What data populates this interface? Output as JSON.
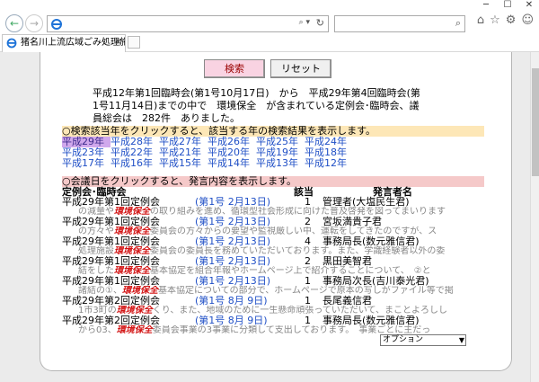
{
  "browser": {
    "tab_title": "猪名川上流広域ごみ処理施...",
    "address": "",
    "search_placeholder": ""
  },
  "buttons": {
    "search_label": "検索",
    "reset_label": "リセット"
  },
  "summary": "平成12年第1回臨時会(第1号10月17日)　から　平成29年第4回臨時会(第1号11月14日)までの中で　環境保全　が含まれている定例会･臨時会、議員総会は　282件　ありました。",
  "year_hint": "○検索該当年をクリックすると、該当する年の検索結果を表示します。",
  "years": [
    [
      "平成29年",
      "平成28年",
      "平成27年",
      "平成26年",
      "平成25年",
      "平成24年"
    ],
    [
      "平成23年",
      "平成22年",
      "平成21年",
      "平成20年",
      "平成19年",
      "平成18年"
    ],
    [
      "平成17年",
      "平成16年",
      "平成15年",
      "平成14年",
      "平成13年",
      "平成12年"
    ]
  ],
  "speaker_hint": "○会議日をクリックすると、発言内容を表示します。",
  "headers": {
    "meeting": "定例会･臨時会",
    "hit": "該当",
    "speaker": "発言者名"
  },
  "results": [
    {
      "meeting": "平成29年第1回定例会",
      "date": "(第1号 2月13日)",
      "count": "1",
      "speaker": "管理者(大塩民生君)",
      "pre": "　の減量や",
      "kw": "環境保全",
      "post": "の取り組みを進め、循環型社会形成に向けた普及啓発を図ってまいります"
    },
    {
      "meeting": "平成29年第1回定例会",
      "date": "(第1号 2月13日)",
      "count": "2",
      "speaker": "宮坂満貴子君",
      "pre": "　の方々や",
      "kw": "環境保全",
      "post": "委員会の方々からの要望や監視厳しい中、運転をしてきたのですが、ス"
    },
    {
      "meeting": "平成29年第1回定例会",
      "date": "(第1号 2月13日)",
      "count": "4",
      "speaker": "事務局長(数元雅信君)",
      "pre": "　処理施設",
      "kw": "環境保全",
      "post": "委員会の委員長を務めていただいております。また、学識経験者以外の委"
    },
    {
      "meeting": "平成29年第1回定例会",
      "date": "(第1号 2月13日)",
      "count": "2",
      "speaker": "黒田美智君",
      "pre": "　結をした",
      "kw": "環境保全",
      "post": "基本協定を組合年報やホームページ上で紹介することについて、　②と"
    },
    {
      "meeting": "平成29年第1回定例会",
      "date": "(第1号 2月13日)",
      "count": "1",
      "speaker": "事務局次長(吉川泰光君)",
      "pre": "　諸結の①、",
      "kw": "環境保全",
      "post": "基本協定についての部分で、ホームページで原本の写しがファイル等で掲"
    },
    {
      "meeting": "平成29年第2回定例会",
      "date": "(第1号 8月 9日)",
      "count": "1",
      "speaker": "長尾義信君",
      "pre": "　1市3町の",
      "kw": "環境保全",
      "post": "くり、また、地域のために一生懸命頑張っていただいて、まことよろしし"
    },
    {
      "meeting": "平成29年第2回定例会",
      "date": "(第1号 8月 9日)",
      "count": "1",
      "speaker": "事務局長(数元雅信君)",
      "pre": "　から03、",
      "kw": "環境保全",
      "post": "委員会事業の3事業に分類して支出しております。　事業ごとに主だっ"
    }
  ],
  "option_select": "オプション"
}
